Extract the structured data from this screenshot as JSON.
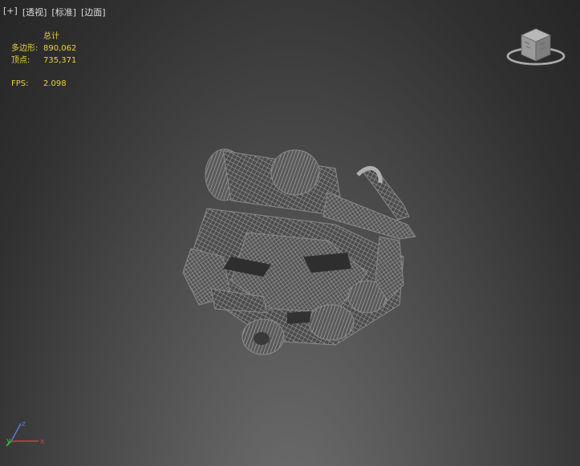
{
  "viewport_menu": {
    "plus": "[+]",
    "view": "[透视]",
    "shading": "[标准]",
    "edges": "[边面]"
  },
  "stats": {
    "header": "总计",
    "polygons_label": "多边形:",
    "polygons_value": "890,062",
    "vertices_label": "顶点:",
    "vertices_value": "735,371",
    "fps_label": "FPS:",
    "fps_value": "2.098"
  },
  "viewcube": {
    "icon": "viewcube-icon"
  },
  "axis_tripod": {
    "x": "x",
    "y": "y",
    "z": "z",
    "colors": {
      "x": "#d04040",
      "y": "#40c040",
      "z": "#5080e0"
    }
  },
  "colors": {
    "stats_text": "#e8d23a",
    "menu_text": "#dcdcdc",
    "wireframe": "#9a9a9a"
  }
}
